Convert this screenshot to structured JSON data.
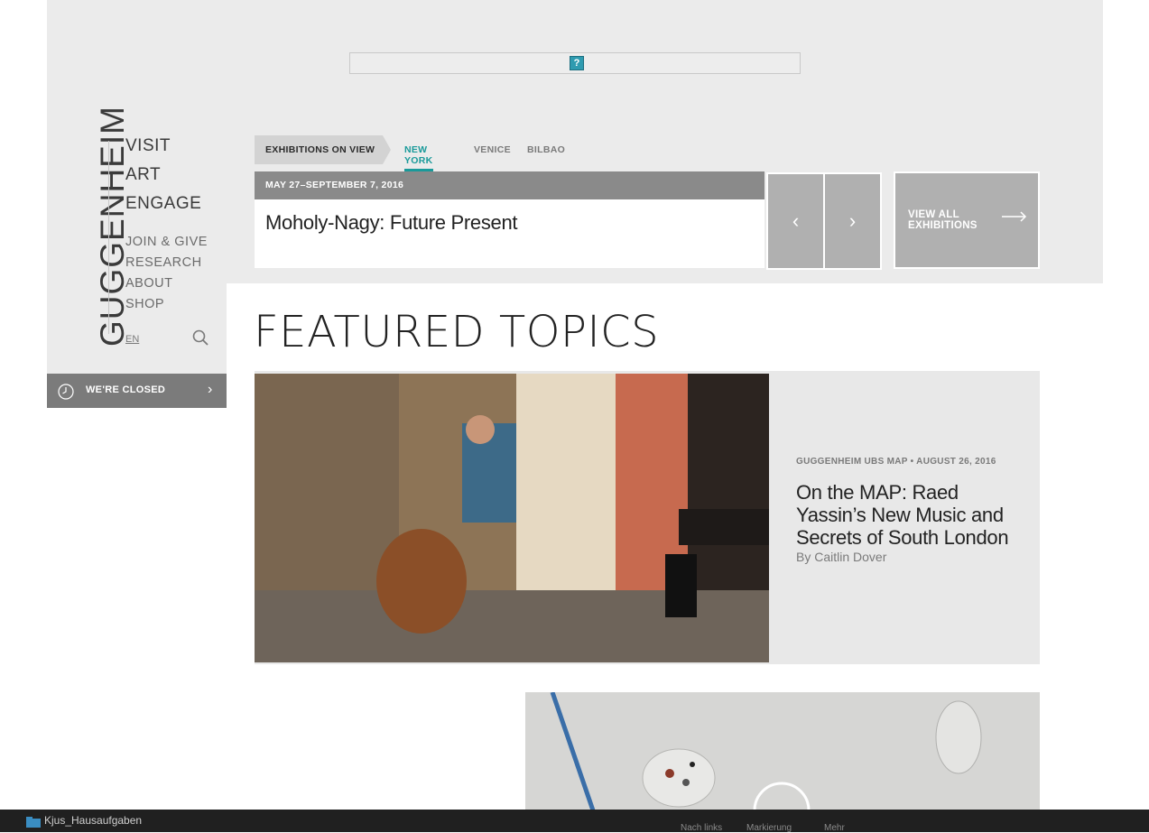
{
  "ad": {
    "icon": "?"
  },
  "brand": {
    "logo": "GUGGENHEIM"
  },
  "nav": {
    "main": [
      "VISIT",
      "ART",
      "ENGAGE"
    ],
    "secondary": [
      "JOIN & GIVE",
      "RESEARCH",
      "ABOUT",
      "SHOP"
    ],
    "language": "EN"
  },
  "status": {
    "closed_label": "WE'RE CLOSED"
  },
  "exhibitions": {
    "heading": "EXHIBITIONS ON VIEW",
    "cities": [
      "NEW YORK",
      "VENICE",
      "BILBAO"
    ],
    "active_city": "NEW YORK",
    "current": {
      "date": "MAY 27–SEPTEMBER 7, 2016",
      "title": "Moholy-Nagy: Future Present"
    },
    "view_all": "VIEW ALL EXHIBITIONS"
  },
  "featured": {
    "heading": "FEATURED TOPICS",
    "article": {
      "source": "GUGGENHEIM UBS MAP",
      "date": "AUGUST 26, 2016",
      "title": "On the MAP: Raed Yassin’s New Music and Secrets of South London",
      "byline": "By Caitlin Dover"
    }
  },
  "dock": {
    "folder": "Kjus_Hausaufgaben",
    "items": [
      "Nach links",
      "Markierung",
      "Mehr"
    ]
  },
  "colors": {
    "accent": "#1a9a9a",
    "header_bg": "#ebebeb",
    "button_grey": "#b0b0b0"
  }
}
